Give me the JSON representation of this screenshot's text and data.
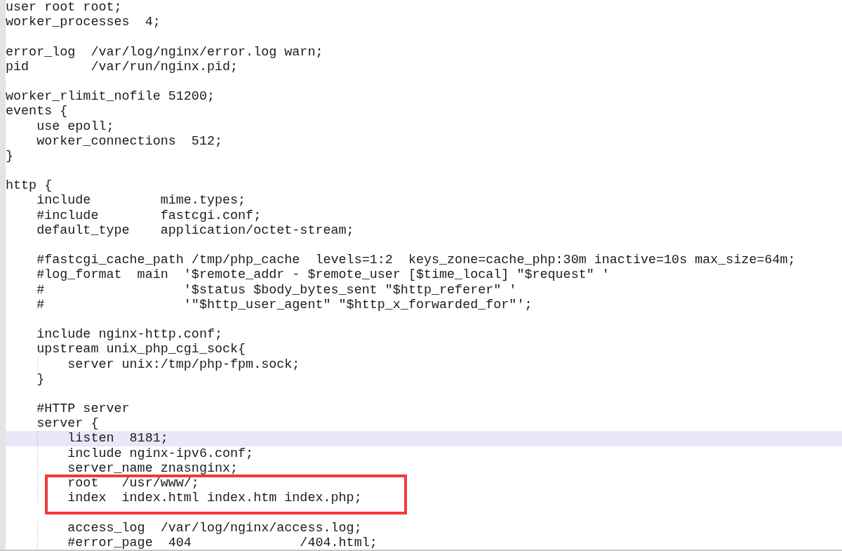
{
  "editor": {
    "lines": [
      {
        "kind": "code",
        "text": "user root root;",
        "highlighted": false,
        "boxed": false
      },
      {
        "kind": "code",
        "text": "worker_processes  4;",
        "highlighted": false,
        "boxed": false
      },
      {
        "kind": "blank"
      },
      {
        "kind": "code",
        "text": "error_log  /var/log/nginx/error.log warn;",
        "highlighted": false,
        "boxed": false
      },
      {
        "kind": "code",
        "text": "pid        /var/run/nginx.pid;",
        "highlighted": false,
        "boxed": false
      },
      {
        "kind": "blank"
      },
      {
        "kind": "code",
        "text": "worker_rlimit_nofile 51200;",
        "highlighted": false,
        "boxed": false
      },
      {
        "kind": "code",
        "text": "events {",
        "highlighted": false,
        "boxed": false
      },
      {
        "kind": "code",
        "text": "    use epoll;",
        "highlighted": false,
        "boxed": false
      },
      {
        "kind": "code",
        "text": "    worker_connections  512;",
        "highlighted": false,
        "boxed": false
      },
      {
        "kind": "code",
        "text": "}",
        "highlighted": false,
        "boxed": false
      },
      {
        "kind": "blank"
      },
      {
        "kind": "code",
        "text": "http {",
        "highlighted": false,
        "boxed": false
      },
      {
        "kind": "code",
        "text": "    include         mime.types;",
        "highlighted": false,
        "boxed": false
      },
      {
        "kind": "code",
        "text": "    #include        fastcgi.conf;",
        "highlighted": false,
        "boxed": false
      },
      {
        "kind": "code",
        "text": "    default_type    application/octet-stream;",
        "highlighted": false,
        "boxed": false
      },
      {
        "kind": "blank"
      },
      {
        "kind": "code",
        "text": "    #fastcgi_cache_path /tmp/php_cache  levels=1:2  keys_zone=cache_php:30m inactive=10s max_size=64m;",
        "highlighted": false,
        "boxed": false
      },
      {
        "kind": "code",
        "text": "    #log_format  main  '$remote_addr - $remote_user [$time_local] \"$request\" '",
        "highlighted": false,
        "boxed": false
      },
      {
        "kind": "code",
        "text": "    #                  '$status $body_bytes_sent \"$http_referer\" '",
        "highlighted": false,
        "boxed": false
      },
      {
        "kind": "code",
        "text": "    #                  '\"$http_user_agent\" \"$http_x_forwarded_for\"';",
        "highlighted": false,
        "boxed": false
      },
      {
        "kind": "blank"
      },
      {
        "kind": "code",
        "text": "    include nginx-http.conf;",
        "highlighted": false,
        "boxed": false
      },
      {
        "kind": "code",
        "text": "    upstream unix_php_cgi_sock{",
        "highlighted": false,
        "boxed": false
      },
      {
        "kind": "code",
        "text": "        server unix:/tmp/php-fpm.sock;",
        "highlighted": false,
        "boxed": false
      },
      {
        "kind": "code",
        "text": "    }",
        "highlighted": false,
        "boxed": false
      },
      {
        "kind": "blank"
      },
      {
        "kind": "code",
        "text": "    #HTTP server",
        "highlighted": false,
        "boxed": false
      },
      {
        "kind": "code",
        "text": "    server {",
        "highlighted": false,
        "boxed": false
      },
      {
        "kind": "code",
        "text": "        listen  8181;",
        "highlighted": true,
        "boxed": false
      },
      {
        "kind": "code",
        "text": "        include nginx-ipv6.conf;",
        "highlighted": false,
        "boxed": false
      },
      {
        "kind": "code",
        "text": "        server_name znasnginx;",
        "highlighted": false,
        "boxed": false
      },
      {
        "kind": "code",
        "text": "        root   /usr/www/;",
        "highlighted": false,
        "boxed": true
      },
      {
        "kind": "code",
        "text": "        index  index.html index.htm index.php;",
        "highlighted": false,
        "boxed": true
      },
      {
        "kind": "blank"
      },
      {
        "kind": "code",
        "text": "        access_log  /var/log/nginx/access.log;",
        "highlighted": false,
        "boxed": false
      },
      {
        "kind": "code",
        "text": "        #error_page  404              /404.html;",
        "highlighted": false,
        "boxed": false
      }
    ]
  }
}
